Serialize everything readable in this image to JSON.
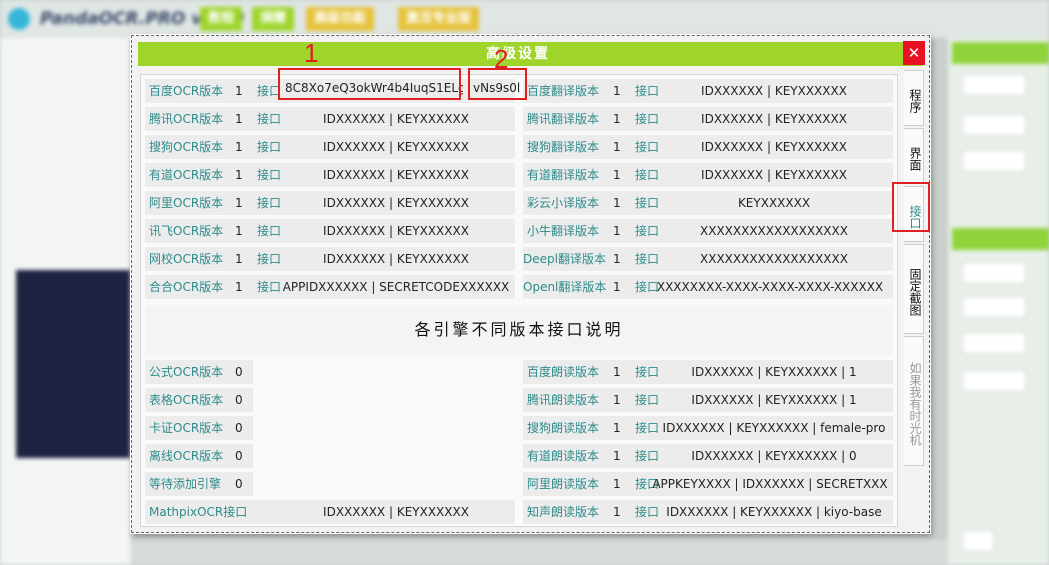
{
  "background": {
    "app_title": "PandaOCR.PRO v5.39",
    "top_buttons": [
      "教程",
      "捐赠",
      "高级功能",
      "激活专业版"
    ]
  },
  "dialog": {
    "title": "高级设置",
    "close_label": "✕",
    "left_rows": [
      {
        "label": "百度OCR版本",
        "version": "1",
        "iface": "接口",
        "value": "8C8Xo7eQ3okWr4b4IuqS1ELg|"
      },
      {
        "label": "腾讯OCR版本",
        "version": "1",
        "iface": "接口",
        "value": "IDXXXXXX | KEYXXXXXX"
      },
      {
        "label": "搜狗OCR版本",
        "version": "1",
        "iface": "接口",
        "value": "IDXXXXXX | KEYXXXXXX"
      },
      {
        "label": "有道OCR版本",
        "version": "1",
        "iface": "接口",
        "value": "IDXXXXXX | KEYXXXXXX"
      },
      {
        "label": "阿里OCR版本",
        "version": "1",
        "iface": "接口",
        "value": "IDXXXXXX | KEYXXXXXX"
      },
      {
        "label": "讯飞OCR版本",
        "version": "1",
        "iface": "接口",
        "value": "IDXXXXXX | KEYXXXXXX"
      },
      {
        "label": "网校OCR版本",
        "version": "1",
        "iface": "接口",
        "value": "IDXXXXXX | KEYXXXXXX"
      },
      {
        "label": "合合OCR版本",
        "version": "1",
        "iface": "接口",
        "value": "APPIDXXXXXX | SECRETCODEXXXXXX"
      }
    ],
    "key_field2": "vNs9s0l",
    "right_rows": [
      {
        "label": "百度翻译版本",
        "version": "1",
        "iface": "接口",
        "value": "IDXXXXXX | KEYXXXXXX"
      },
      {
        "label": "腾讯翻译版本",
        "version": "1",
        "iface": "接口",
        "value": "IDXXXXXX | KEYXXXXXX"
      },
      {
        "label": "搜狗翻译版本",
        "version": "1",
        "iface": "接口",
        "value": "IDXXXXXX | KEYXXXXXX"
      },
      {
        "label": "有道翻译版本",
        "version": "1",
        "iface": "接口",
        "value": "IDXXXXXX | KEYXXXXXX"
      },
      {
        "label": "彩云小译版本",
        "version": "1",
        "iface": "接口",
        "value": "KEYXXXXXX"
      },
      {
        "label": "小牛翻译版本",
        "version": "1",
        "iface": "接口",
        "value": "XXXXXXXXXXXXXXXXXX"
      },
      {
        "label": "Deepl翻译版本",
        "version": "1",
        "iface": "接口",
        "value": "XXXXXXXXXXXXXXXXXX"
      },
      {
        "label": "Openl翻译版本",
        "version": "1",
        "iface": "接口",
        "value": "XXXXXXXX-XXXX-XXXX-XXXX-XXXXXX"
      }
    ],
    "explain_text": "各引擎不同版本接口说明",
    "lower_left_rows": [
      {
        "label": "公式OCR版本",
        "version": "0"
      },
      {
        "label": "表格OCR版本",
        "version": "0"
      },
      {
        "label": "卡证OCR版本",
        "version": "0"
      },
      {
        "label": "离线OCR版本",
        "version": "0"
      },
      {
        "label": "等待添加引擎",
        "version": "0"
      }
    ],
    "mathpix": {
      "label": "MathpixOCR接口",
      "value": "IDXXXXXX | KEYXXXXXX"
    },
    "lower_right_rows": [
      {
        "label": "百度朗读版本",
        "version": "1",
        "iface": "接口",
        "value": "IDXXXXXX | KEYXXXXXX | 1"
      },
      {
        "label": "腾讯朗读版本",
        "version": "1",
        "iface": "接口",
        "value": "IDXXXXXX | KEYXXXXXX | 1"
      },
      {
        "label": "搜狗朗读版本",
        "version": "1",
        "iface": "接口",
        "value": "IDXXXXXX | KEYXXXXXX | female-pro"
      },
      {
        "label": "有道朗读版本",
        "version": "1",
        "iface": "接口",
        "value": "IDXXXXXX | KEYXXXXXX | 0"
      },
      {
        "label": "阿里朗读版本",
        "version": "1",
        "iface": "接口",
        "value": "APPKEYXXXX | IDXXXXXX | SECRETXXX"
      },
      {
        "label": "知声朗读版本",
        "version": "1",
        "iface": "接口",
        "value": "IDXXXXXX | KEYXXXXXX | kiyo-base"
      }
    ],
    "tabs": [
      "程序",
      "界面",
      "接口",
      "固定截图",
      "如果我有时光机"
    ],
    "active_tab": "接口"
  },
  "annotations": [
    "1",
    "2"
  ],
  "colors": {
    "titlebar": "#9fd52b",
    "label": "#2e8b8b",
    "close": "#e81123",
    "annotation": "#e02020"
  }
}
